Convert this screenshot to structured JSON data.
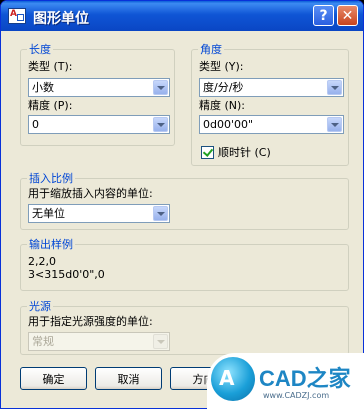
{
  "window": {
    "title": "图形单位",
    "help_glyph": "?",
    "close_glyph": "✕"
  },
  "length": {
    "legend": "长度",
    "type_label": "类型 (T):",
    "type_value": "小数",
    "precision_label": "精度 (P):",
    "precision_value": "0"
  },
  "angle": {
    "legend": "角度",
    "type_label": "类型 (Y):",
    "type_value": "度/分/秒",
    "precision_label": "精度 (N):",
    "precision_value": "0d00'00\"",
    "clockwise_label": "顺时针 (C)",
    "clockwise_checked": true
  },
  "insert_scale": {
    "legend": "插入比例",
    "label": "用于缩放插入内容的单位:",
    "value": "无单位"
  },
  "sample_output": {
    "legend": "输出样例",
    "line1": "2,2,0",
    "line2": "3<315d0'0\",0"
  },
  "lighting": {
    "legend": "光源",
    "label": "用于指定光源强度的单位:",
    "value": "常规"
  },
  "buttons": {
    "ok": "确定",
    "cancel": "取消",
    "direction": "方向"
  },
  "watermark": {
    "logo": "A",
    "text": "CAD之家",
    "url": "www.CADZJ.com"
  },
  "colors": {
    "title_bar": "#0a46c4",
    "group_legend": "#0046d5",
    "dialog_bg": "#ece9d8"
  }
}
